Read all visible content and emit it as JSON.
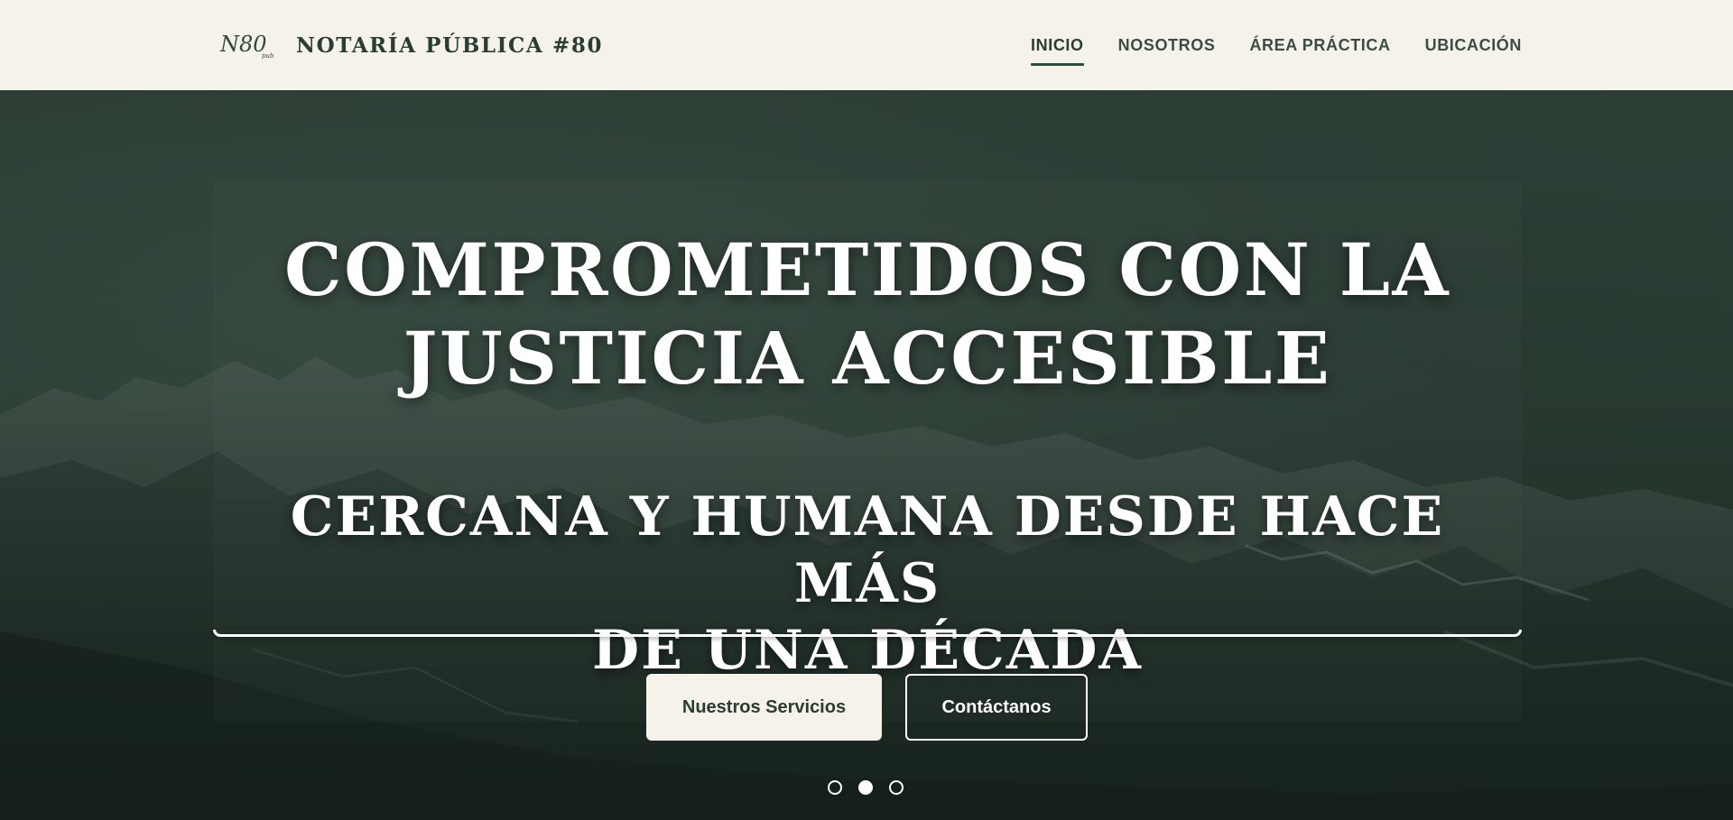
{
  "brand": {
    "logo_text": "N80",
    "logo_subtext": "pub",
    "name": "NOTARÍA PÚBLICA #80"
  },
  "nav": {
    "items": [
      {
        "label": "INICIO",
        "active": true
      },
      {
        "label": "NOSOTROS",
        "active": false
      },
      {
        "label": "ÁREA PRÁCTICA",
        "active": false
      },
      {
        "label": "UBICACIÓN",
        "active": false
      }
    ]
  },
  "hero": {
    "title_line1": "COMPROMETIDOS CON LA",
    "title_line2": "JUSTICIA ACCESIBLE",
    "subtitle_line1": "CERCANA Y HUMANA DESDE HACE MÁS",
    "subtitle_line2": "DE UNA DÉCADA",
    "primary_button": "Nuestros Servicios",
    "secondary_button": "Contáctanos",
    "carousel": {
      "slides": 3,
      "active_index": 1
    }
  },
  "colors": {
    "header_bg": "#f5f2ea",
    "brand_green": "#2a3d31",
    "hero_overlay": "#26352d",
    "text_light": "#ffffff"
  }
}
